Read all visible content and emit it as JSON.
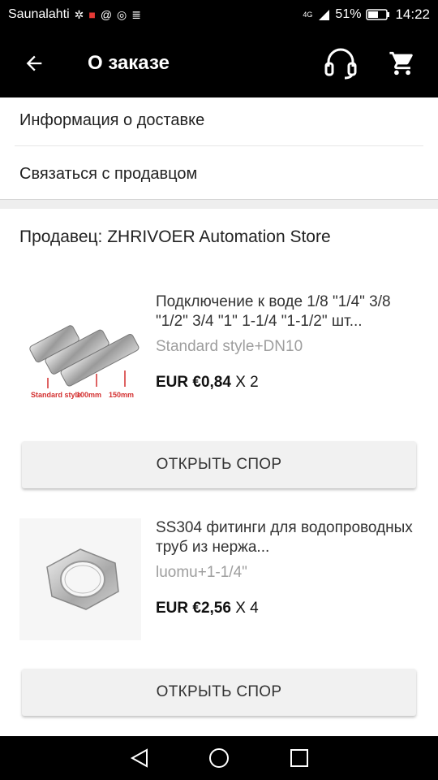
{
  "status_bar": {
    "carrier": "Saunalahti",
    "signal": "4G",
    "battery": "51%",
    "time": "14:22",
    "icons": [
      "bug-icon",
      "mail-icon",
      "at-icon",
      "whatsapp-icon",
      "storage-icon"
    ]
  },
  "app_bar": {
    "title": "О заказе",
    "icons": [
      "back-arrow-icon",
      "support-headset-icon",
      "cart-icon"
    ]
  },
  "menu": {
    "delivery_info": "Информация о доставке",
    "contact_seller": "Связаться с продавцом"
  },
  "seller": {
    "label": "Продавец: ZHRIVOER Automation Store"
  },
  "products": [
    {
      "title": "Подключение к воде 1/8 \"1/4\" 3/8 \"1/2\" 3/4 \"1\" 1-1/4 \"1-1/2\" шт...",
      "variant": "Standard style+DN10",
      "price": "EUR €0,84",
      "qty": " X 2",
      "image_labels": [
        "Standard style",
        "100mm",
        "150mm"
      ],
      "dispute_label": "ОТКРЫТЬ СПОР"
    },
    {
      "title": "SS304 фитинги для водопроводных труб из нержа...",
      "variant": "luomu+1-1/4\"",
      "price": "EUR €2,56",
      "qty": " X 4",
      "dispute_label": "ОТКРЫТЬ СПОР"
    }
  ],
  "nav_bar": {
    "icons": [
      "nav-back-icon",
      "nav-home-icon",
      "nav-recents-icon"
    ]
  },
  "colors": {
    "bar_background": "#000000",
    "page_background": "#ffffff",
    "button_background": "#f1f1f1",
    "variant_text": "#9e9e9e"
  }
}
